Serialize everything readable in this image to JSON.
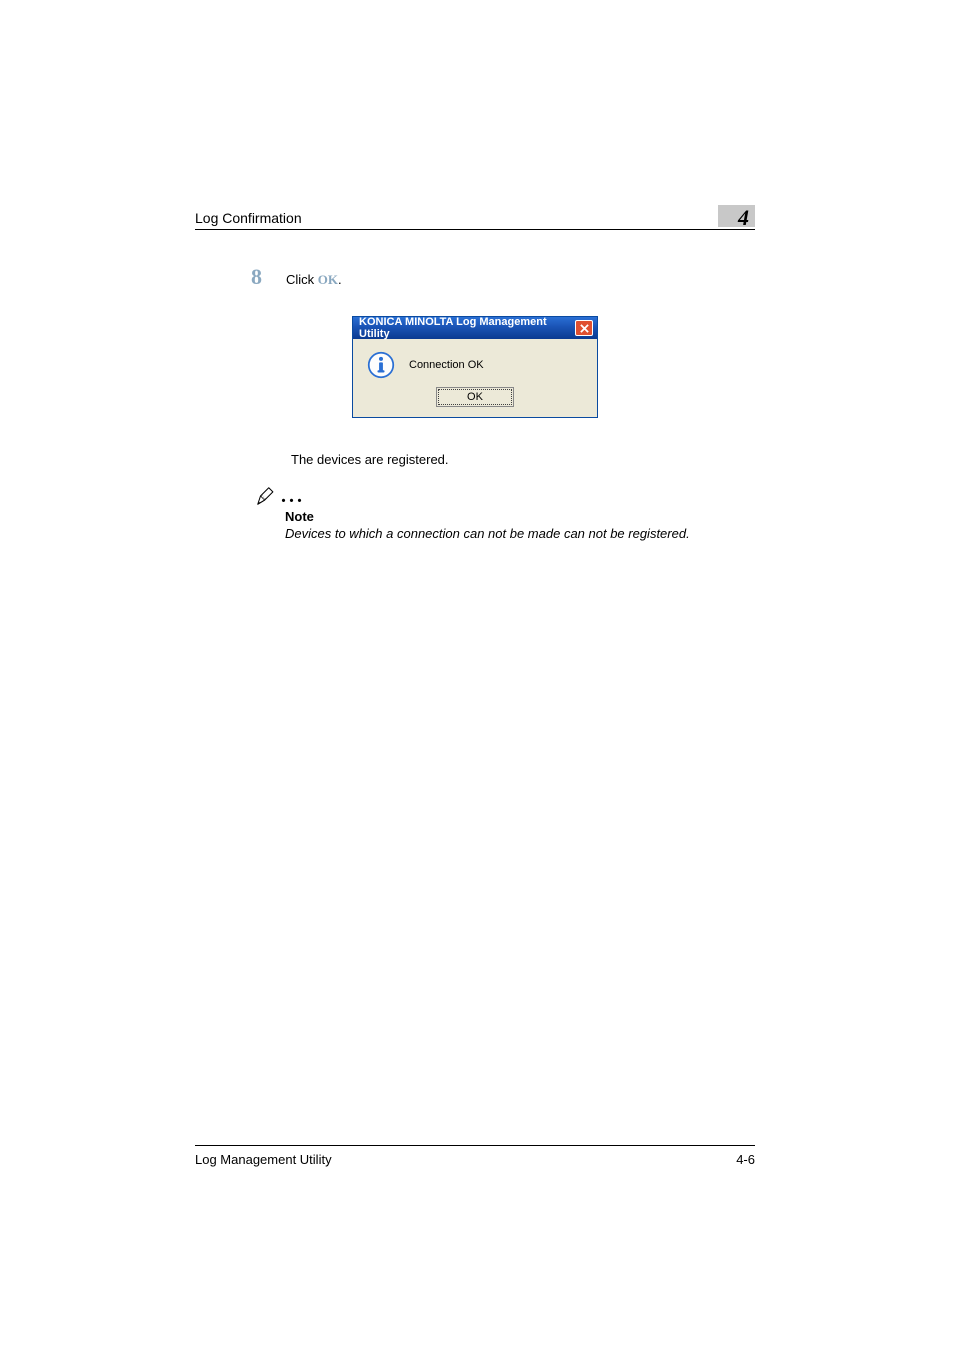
{
  "header": {
    "section_title": "Log Confirmation",
    "chapter_number": "4"
  },
  "step": {
    "number": "8",
    "prefix": "Click ",
    "action_label": "OK",
    "suffix": "."
  },
  "dialog": {
    "title": "KONICA MINOLTA Log Management Utility",
    "message": "Connection OK",
    "ok_label": "OK"
  },
  "result": "The devices are registered.",
  "note": {
    "label": "Note",
    "body": "Devices to which a connection can not be made can not be registered."
  },
  "footer": {
    "product": "Log Management Utility",
    "page": "4-6"
  }
}
